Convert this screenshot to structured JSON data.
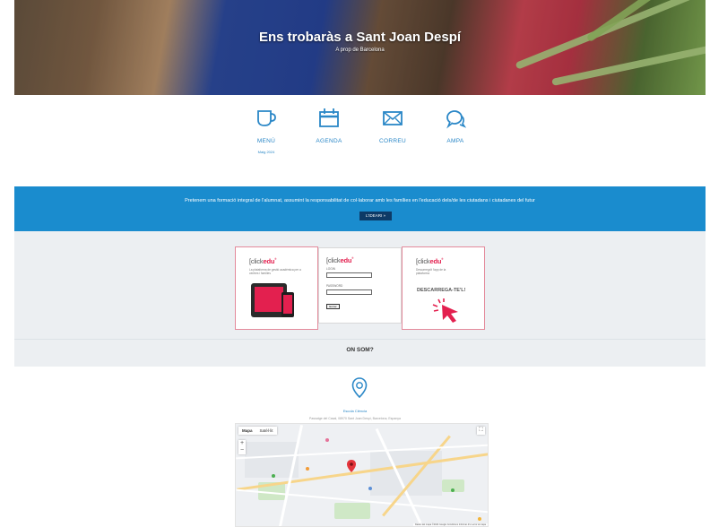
{
  "hero": {
    "title": "Ens trobaràs a Sant Joan Despí",
    "subtitle": "A prop de Barcelona"
  },
  "quick_links": [
    {
      "label": "MENÚ",
      "sub": "Maig 2024",
      "icon": "cup-icon"
    },
    {
      "label": "AGENDA",
      "sub": "",
      "icon": "calendar-icon"
    },
    {
      "label": "CORREU",
      "sub": "",
      "icon": "envelope-icon"
    },
    {
      "label": "AMPA",
      "sub": "",
      "icon": "chat-bubbles-icon"
    }
  ],
  "mission": {
    "text": "Pretenem una formació integral de l'alumnat, assumint la responsabilitat de col·laborar amb les famílies en l'educació dels/de les ciutadans i ciutadanes del futur",
    "button": "L'IDEARI »"
  },
  "clickedu": {
    "brand_prefix": "[click",
    "brand_main": "edu",
    "brand_suffix": "®",
    "card1_desc": "La plataforma de gestió acadèmica per a centres i famílies",
    "login_label": "LOGIN",
    "password_label": "PASSWORD",
    "submit_label": "Entrar",
    "card3_desc": "Descarrega't l'app de la plataforma",
    "download_label": "DESCARREGA-TE'L!"
  },
  "location": {
    "heading": "ON SOM?",
    "title": "Escola Ciència",
    "address": "Passatge del Casal, 08970 Sant Joan Despí, Barcelona, Espanya"
  },
  "map": {
    "tab_map": "Mapa",
    "tab_satellite": "Satèl·lit",
    "zoom_in": "+",
    "zoom_out": "−",
    "attribution": "Dades del mapa ©2024 Google  Condicions  Informar d'un error al mapa"
  },
  "colors": {
    "accent": "#1a8cce",
    "brand_red": "#e3204f",
    "link": "#2a87c7"
  }
}
